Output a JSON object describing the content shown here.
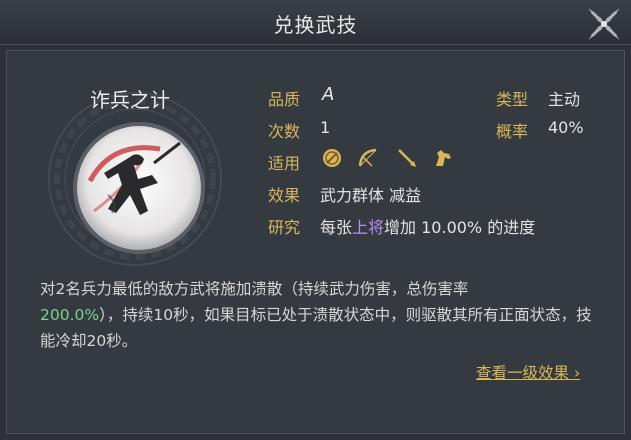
{
  "window": {
    "title": "兑换武技"
  },
  "skill": {
    "name": "诈兵之计",
    "icon": "running-warrior-icon"
  },
  "stats": {
    "quality_label": "品质",
    "quality_value": "A",
    "type_label": "类型",
    "type_value": "主动",
    "count_label": "次数",
    "count_value": "1",
    "rate_label": "概率",
    "rate_value": "40%",
    "applicable_label": "适用",
    "applicable_icons": [
      "shield-icon",
      "bow-icon",
      "spear-icon",
      "horse-icon"
    ],
    "effect_label": "效果",
    "effect_value": "武力群体 减益",
    "research_label": "研究",
    "research_prefix": "每张",
    "research_highlight": "上将",
    "research_suffix": "增加 10.00% 的进度"
  },
  "description": {
    "part1": "对2名兵力最低的敌方武将施加溃散（持续武力伤害，总伤害率",
    "percent": "200.0%",
    "part2": "），持续10秒，如果目标已处于溃散状态中，则驱散其所有正面状态，技能冷却20秒。"
  },
  "footer": {
    "more_link": "查看一级效果"
  },
  "colors": {
    "label_gold": "#d9b65a",
    "highlight_purple": "#b691f0",
    "percent_green": "#7ed08a"
  }
}
